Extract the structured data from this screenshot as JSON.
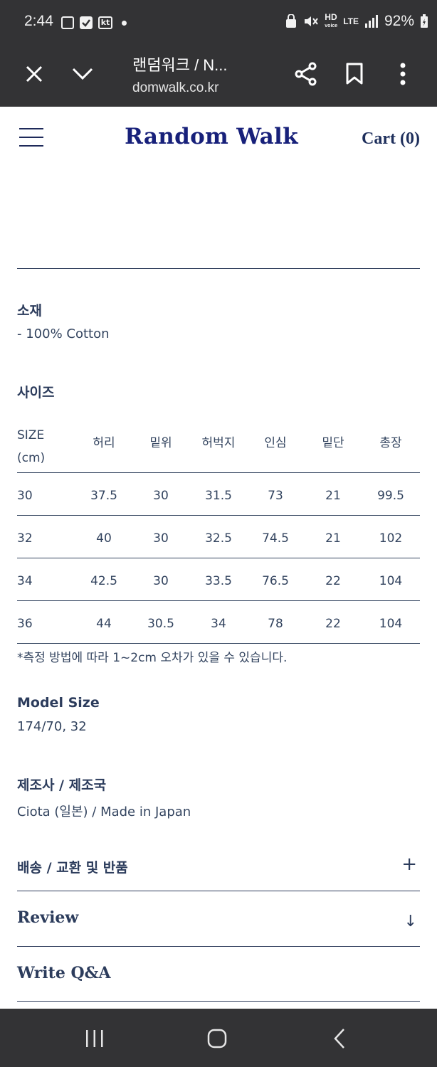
{
  "status_bar": {
    "time": "2:44",
    "network": "LTE",
    "battery_text": "92%",
    "icons": [
      "gallery-icon",
      "checkbox-icon",
      "kt-icon",
      "notification-dot",
      "vpn-icon",
      "mute-icon",
      "hd-voice-icon",
      "lte-icon",
      "signal-icon",
      "battery-icon"
    ]
  },
  "browser": {
    "page_title": "랜덤워크 / N...",
    "url": "domwalk.co.kr",
    "icons": [
      "close-icon",
      "chevron-down-icon",
      "share-icon",
      "bookmark-icon",
      "more-vertical-icon"
    ]
  },
  "site_header": {
    "logo": "Random Walk",
    "cart_label": "Cart (0)",
    "brand_color": "#17207a"
  },
  "material": {
    "title": "소재",
    "value": "- 100% Cotton"
  },
  "sizes": {
    "title": "사이즈",
    "header_first_line1": "SIZE",
    "header_first_line2": "(cm)",
    "columns": [
      "허리",
      "밑위",
      "허벅지",
      "인심",
      "밑단",
      "총장"
    ],
    "rows": [
      [
        "30",
        "37.5",
        "30",
        "31.5",
        "73",
        "21",
        "99.5"
      ],
      [
        "32",
        "40",
        "30",
        "32.5",
        "74.5",
        "21",
        "102"
      ],
      [
        "34",
        "42.5",
        "30",
        "33.5",
        "76.5",
        "22",
        "104"
      ],
      [
        "36",
        "44",
        "30.5",
        "34",
        "78",
        "22",
        "104"
      ]
    ],
    "note": "*측정 방법에 따라 1~2cm 오차가 있을 수 있습니다."
  },
  "model_size": {
    "title": "Model Size",
    "value": "174/70, 32"
  },
  "manufacturer": {
    "title": "제조사 / 제조국",
    "value": "Ciota (일본) / Made in Japan"
  },
  "accordions": {
    "shipping": {
      "label": "배송 / 교환 및 반품",
      "toggle": "+"
    },
    "review": {
      "label": "Review",
      "toggle": "↓"
    },
    "qna": {
      "label": "Write Q&A"
    }
  },
  "nav_bar": {
    "icons": [
      "recent-apps-icon",
      "home-icon",
      "back-icon"
    ]
  }
}
